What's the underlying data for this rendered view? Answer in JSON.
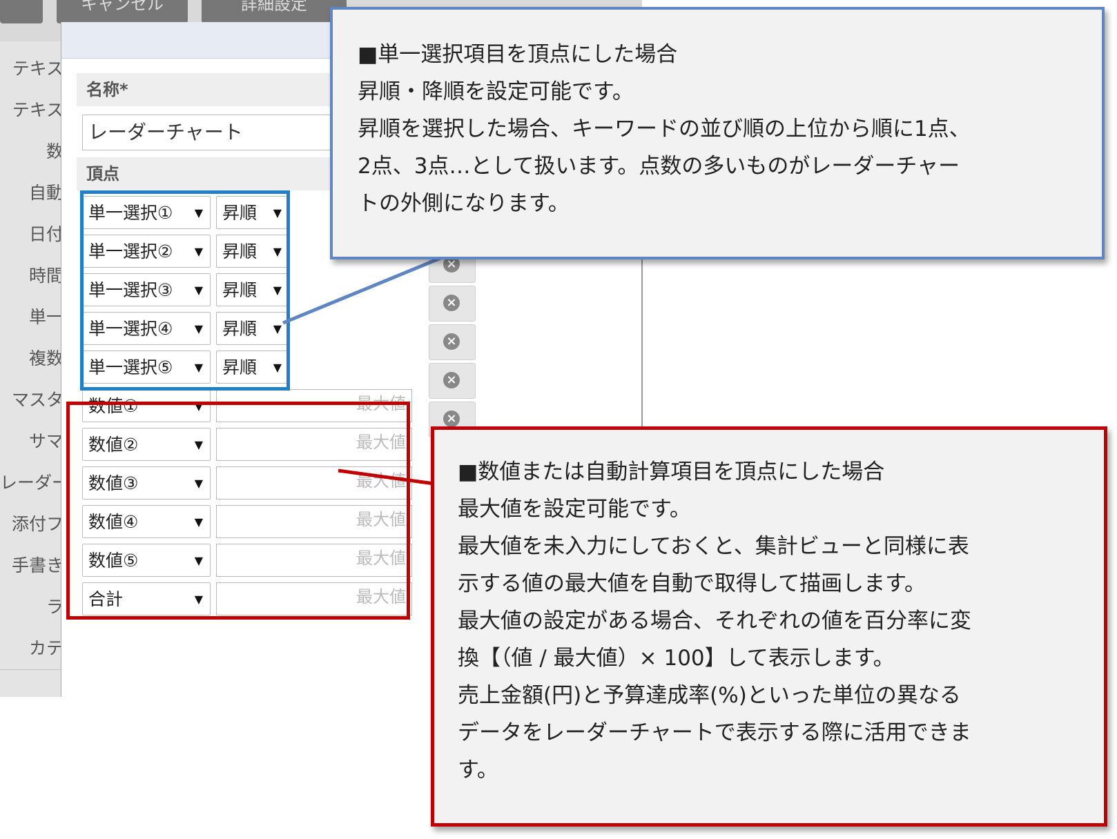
{
  "top_tabs": [
    "キャンセル",
    "詳細設定"
  ],
  "sidebar": {
    "items": [
      "テキス",
      "テキス",
      "数",
      "自動",
      "日付",
      "時間",
      "単一",
      "複数",
      "マスタ",
      "サマ",
      "レーダー",
      "添付フ",
      "手書き",
      "ラ",
      "カテ"
    ]
  },
  "form": {
    "name_label": "名称*",
    "name_value": "レーダーチャート",
    "vertex_label": "頂点",
    "single_rows": [
      {
        "item": "単一選択①",
        "order": "昇順"
      },
      {
        "item": "単一選択②",
        "order": "昇順"
      },
      {
        "item": "単一選択③",
        "order": "昇順"
      },
      {
        "item": "単一選択④",
        "order": "昇順"
      },
      {
        "item": "単一選択⑤",
        "order": "昇順"
      }
    ],
    "numeric_rows": [
      {
        "item": "数値①",
        "max_placeholder": "最大値"
      },
      {
        "item": "数値②",
        "max_placeholder": "最大値"
      },
      {
        "item": "数値③",
        "max_placeholder": "最大値"
      },
      {
        "item": "数値④",
        "max_placeholder": "最大値"
      },
      {
        "item": "数値⑤",
        "max_placeholder": "最大値"
      },
      {
        "item": "合計",
        "max_placeholder": "最大値"
      }
    ],
    "caret_glyph": "▼",
    "delete_glyph": "×"
  },
  "callout_blue": {
    "lines": [
      "■単一選択項目を頂点にした場合",
      "昇順・降順を設定可能です。",
      "昇順を選択した場合、キーワードの並び順の上位から順に1点、",
      "2点、3点…として扱います。点数の多いものがレーダーチャー",
      "トの外側になります。"
    ]
  },
  "callout_red": {
    "lines": [
      "■数値または自動計算項目を頂点にした場合",
      "最大値を設定可能です。",
      "最大値を未入力にしておくと、集計ビューと同様に表",
      "示する値の最大値を自動で取得して描画します。",
      "最大値の設定がある場合、それぞれの値を百分率に変",
      "換【（値 / 最大値）× 100】して表示します。",
      "売上金額(円)と予算達成率(%)といった単位の異なる",
      "データをレーダーチャートで表示する際に活用できま",
      "す。"
    ]
  },
  "colors": {
    "blue_highlight": "#1f80c8",
    "blue_callout_border": "#5f86c2",
    "red_highlight": "#c00000",
    "callout_bg": "#f2f2f2"
  }
}
